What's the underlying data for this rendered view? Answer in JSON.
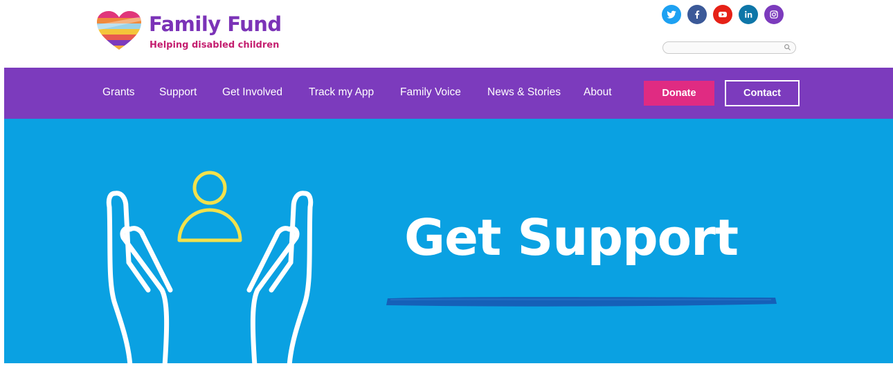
{
  "brand": {
    "title": "Family Fund",
    "tagline": "Helping disabled children",
    "colors": {
      "purple": "#7c3bbd",
      "pink": "#e02b82",
      "hero_blue": "#0aa1e2"
    }
  },
  "social": [
    {
      "name": "twitter-icon",
      "color": "#1da1f2"
    },
    {
      "name": "facebook-icon",
      "color": "#3b5998"
    },
    {
      "name": "youtube-icon",
      "color": "#e62117"
    },
    {
      "name": "linkedin-icon",
      "color": "#0e76a8"
    },
    {
      "name": "instagram-icon",
      "color": "#7c3bbd"
    }
  ],
  "search": {
    "placeholder": "",
    "value": ""
  },
  "nav": {
    "items": [
      "Grants",
      "Support",
      "Get Involved",
      "Track my App",
      "Family Voice",
      "News & Stories",
      "About"
    ],
    "donate_label": "Donate",
    "contact_label": "Contact"
  },
  "hero": {
    "title": "Get Support",
    "icon": "hands-holding-person-icon"
  }
}
